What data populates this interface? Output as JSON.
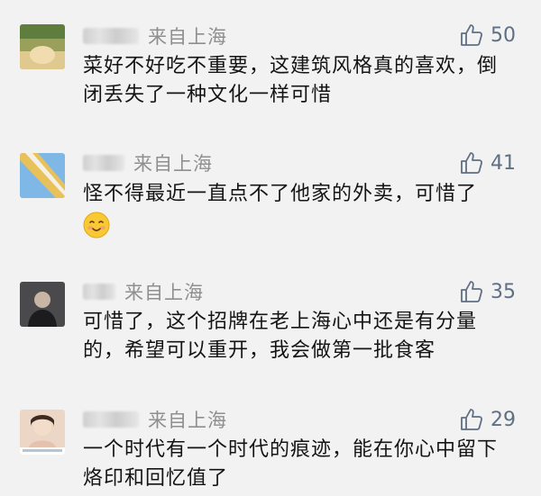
{
  "comments": [
    {
      "location": "来自上海",
      "likes": "50",
      "text": "菜好不好吃不重要，这建筑风格真的喜欢，倒闭丢失了一种文化一样可惜"
    },
    {
      "location": "来自上海",
      "likes": "41",
      "text": "怪不得最近一直点不了他家的外卖，可惜了",
      "emoji": "smiling-face-emoji"
    },
    {
      "location": "来自上海",
      "likes": "35",
      "text": "可惜了，这个招牌在老上海心中还是有分量的，希望可以重开，我会做第一批食客"
    },
    {
      "location": "来自上海",
      "likes": "29",
      "text": "一个时代有一个时代的痕迹，能在你心中留下烙印和回忆值了"
    }
  ],
  "icons": {
    "like": "thumbs-up-icon"
  },
  "colors": {
    "background": "#f2f2f2",
    "like": "#5f6f84",
    "meta": "#8f8f8f"
  }
}
